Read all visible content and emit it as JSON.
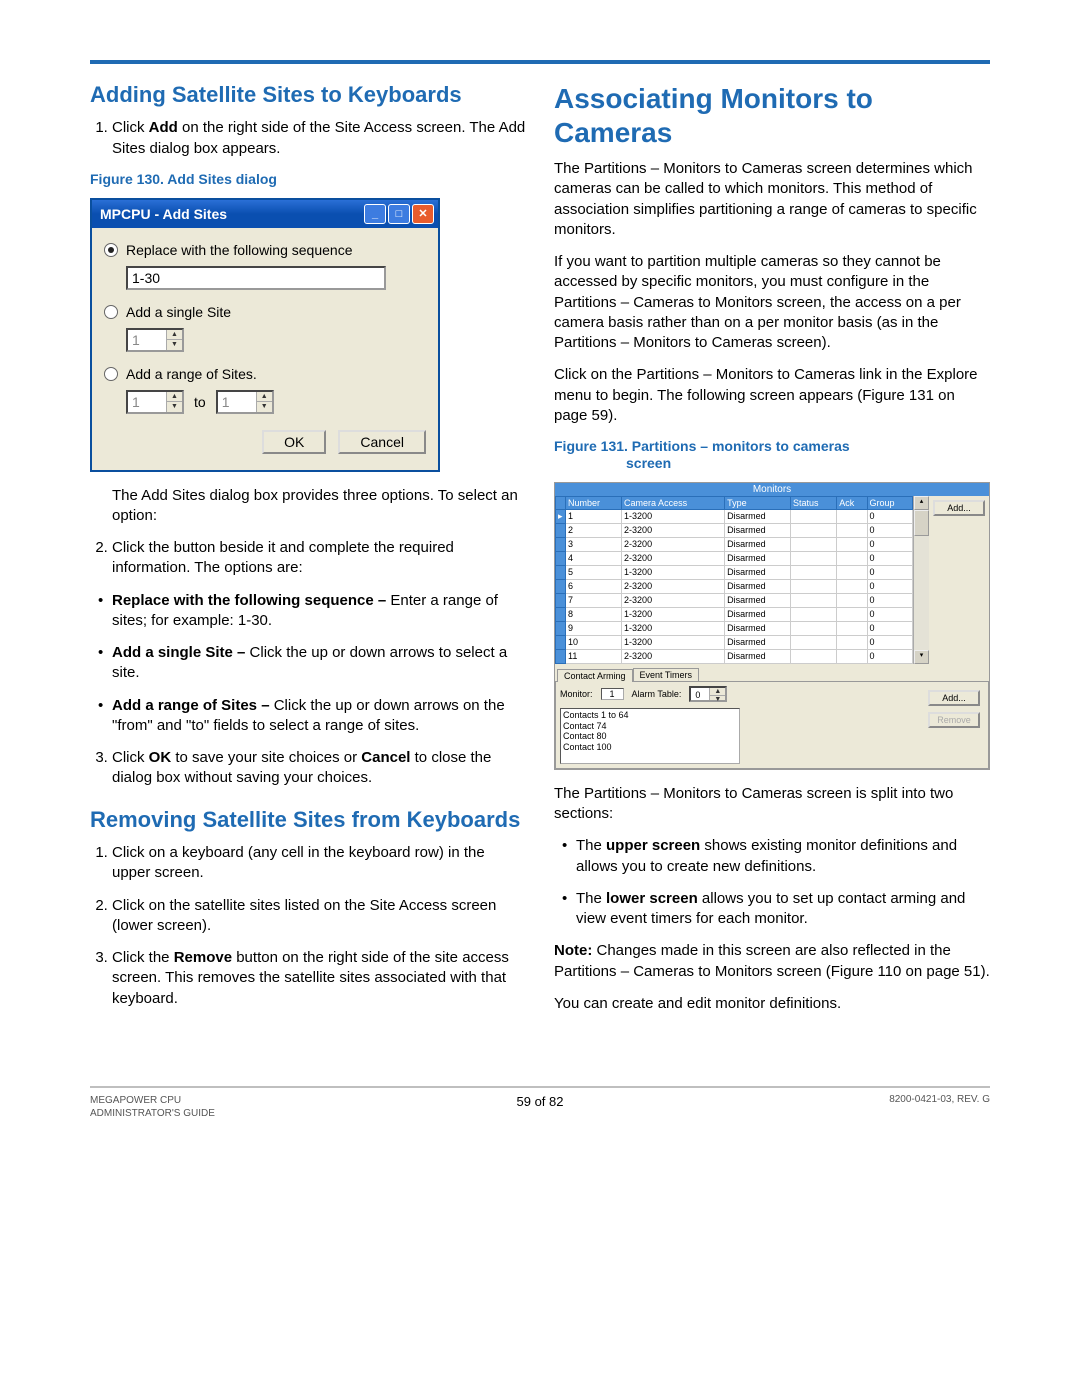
{
  "left": {
    "h_add": "Adding Satellite Sites to Keyboards",
    "step1a": "Click ",
    "step1b": "Add",
    "step1c": " on the right side of the Site Access screen. The Add Sites dialog box appears.",
    "fig130": "Figure 130. Add Sites dialog",
    "dialog": {
      "title": "MPCPU - Add Sites",
      "opt1": "Replace with the following sequence",
      "seq_val": "1-30",
      "opt2": "Add a single Site",
      "single_val": "1",
      "opt3": "Add a range of Sites.",
      "from_val": "1",
      "to_label": "to",
      "to_val": "1",
      "ok": "OK",
      "cancel": "Cancel"
    },
    "after1": "The Add Sites dialog box provides three options. To select an option:",
    "step2": "Click the button beside it and complete the required information. The options are:",
    "b1a": "Replace with the following sequence –",
    "b1b": " Enter a range of sites; for example: 1-30.",
    "b2a": "Add a single Site –",
    "b2b": " Click the up or down arrows to select a site.",
    "b3a": "Add a range of Sites –",
    "b3b": " Click the up or down arrows on the \"from\" and \"to\" fields to select a range of sites.",
    "step3a": "Click ",
    "step3b": "OK",
    "step3c": " to save your site choices or ",
    "step3d": "Cancel",
    "step3e": " to close the dialog box without saving your choices.",
    "h_rem": "Removing Satellite Sites from Keyboards",
    "r1": "Click on a keyboard (any cell in the keyboard row) in the upper screen.",
    "r2": "Click on the satellite sites listed on the Site Access screen (lower screen).",
    "r3a": "Click the ",
    "r3b": "Remove",
    "r3c": " button on the right side of the site access screen. This removes the satellite sites associated with that keyboard."
  },
  "right": {
    "h_assoc": "Associating Monitors to Cameras",
    "p1": "The Partitions – Monitors to Cameras screen determines which cameras can be called to which monitors. This method of association simplifies partitioning a range of cameras to specific monitors.",
    "p2": "If you want to partition multiple cameras so they cannot be accessed by specific monitors, you must configure in the Partitions – Cameras to Monitors screen, the access on a per camera basis rather than on a per monitor basis (as in the Partitions – Monitors to Cameras screen).",
    "p3": "Click on the Partitions – Monitors to Cameras link in the Explore menu to begin. The following screen appears (Figure 131 on page 59).",
    "fig131a": "Figure 131. Partitions – monitors to cameras",
    "fig131b": "screen",
    "mon": {
      "title": "Monitors",
      "cols": [
        "Number",
        "Camera Access",
        "Type",
        "Status",
        "Ack",
        "Group"
      ],
      "rows": [
        {
          "n": "1",
          "c": "1-3200",
          "t": "Disarmed",
          "s": "",
          "a": "",
          "g": "0"
        },
        {
          "n": "2",
          "c": "2-3200",
          "t": "Disarmed",
          "s": "",
          "a": "",
          "g": "0"
        },
        {
          "n": "3",
          "c": "2-3200",
          "t": "Disarmed",
          "s": "",
          "a": "",
          "g": "0"
        },
        {
          "n": "4",
          "c": "2-3200",
          "t": "Disarmed",
          "s": "",
          "a": "",
          "g": "0"
        },
        {
          "n": "5",
          "c": "1-3200",
          "t": "Disarmed",
          "s": "",
          "a": "",
          "g": "0"
        },
        {
          "n": "6",
          "c": "2-3200",
          "t": "Disarmed",
          "s": "",
          "a": "",
          "g": "0"
        },
        {
          "n": "7",
          "c": "2-3200",
          "t": "Disarmed",
          "s": "",
          "a": "",
          "g": "0"
        },
        {
          "n": "8",
          "c": "1-3200",
          "t": "Disarmed",
          "s": "",
          "a": "",
          "g": "0"
        },
        {
          "n": "9",
          "c": "1-3200",
          "t": "Disarmed",
          "s": "",
          "a": "",
          "g": "0"
        },
        {
          "n": "10",
          "c": "1-3200",
          "t": "Disarmed",
          "s": "",
          "a": "",
          "g": "0"
        },
        {
          "n": "11",
          "c": "2-3200",
          "t": "Disarmed",
          "s": "",
          "a": "",
          "g": "0"
        }
      ],
      "add": "Add...",
      "tab1": "Contact Arming",
      "tab2": "Event Timers",
      "monitor_lbl": "Monitor:",
      "monitor_val": "1",
      "alarm_lbl": "Alarm Table:",
      "alarm_val": "0",
      "contacts": [
        "Contacts 1 to 64",
        "Contact 74",
        "Contact 80",
        "Contact 100"
      ],
      "add2": "Add...",
      "remove": "Remove"
    },
    "p4": "The Partitions – Monitors to Cameras screen is split into two sections:",
    "b1a": "The ",
    "b1b": "upper screen",
    "b1c": " shows existing monitor definitions and allows you to create new definitions.",
    "b2a": "The ",
    "b2b": "lower screen",
    "b2c": " allows you to set up contact arming and view event timers for each monitor.",
    "note_a": "Note:",
    "note_b": " Changes made in this screen are also reflected in the Partitions – Cameras to Monitors screen (Figure 110 on page 51).",
    "p5": "You can create and edit monitor definitions."
  },
  "footer": {
    "l1": "MEGAPOWER CPU",
    "l2": "ADMINISTRATOR'S GUIDE",
    "c": "59 of 82",
    "r": "8200-0421-03, REV. G"
  }
}
